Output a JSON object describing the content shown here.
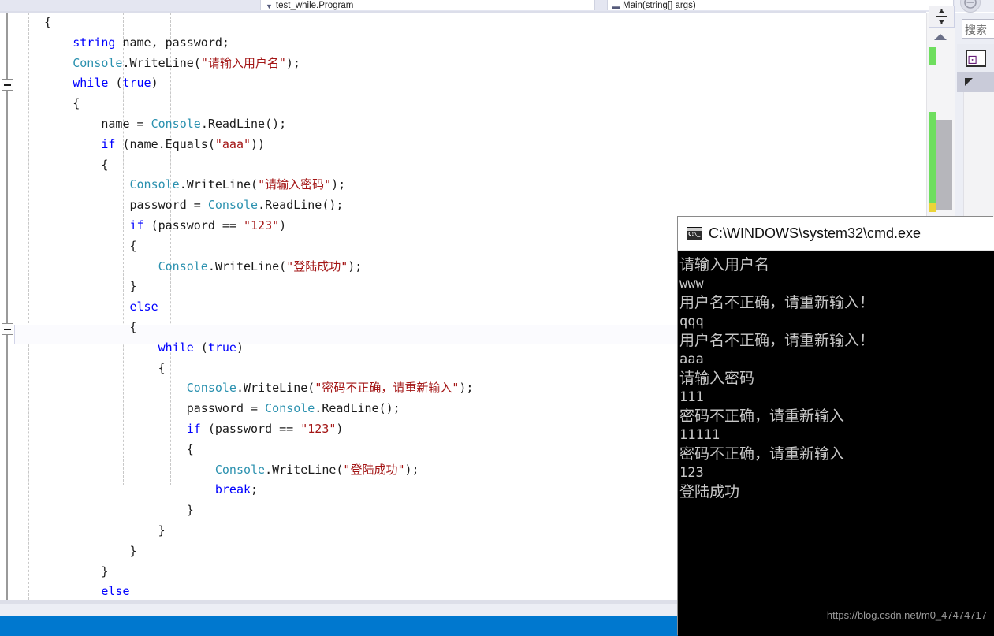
{
  "editor": {
    "tabs": [
      {
        "label": "test_while.Program",
        "icon": "chevron-down-icon"
      },
      {
        "label": "Main(string[] args)",
        "icon": "method-icon"
      }
    ],
    "language": "csharp",
    "current_line_index": 16,
    "colors": {
      "keyword": "#0000ff",
      "type": "#2b91af",
      "string": "#a31515",
      "plain": "#1b1b1b",
      "background": "#ffffff",
      "status_bar": "#0078cf",
      "change_marker": "#6ede5e",
      "warning_marker": "#ebd438"
    },
    "code_lines": [
      [
        {
          "t": "plain",
          "s": "    {"
        }
      ],
      [
        {
          "t": "keyword",
          "s": "        string"
        },
        {
          "t": "plain",
          "s": " name, password;"
        }
      ],
      [
        {
          "t": "type",
          "s": "        Console"
        },
        {
          "t": "plain",
          "s": ".WriteLine("
        },
        {
          "t": "string",
          "s": "\"请输入用户名\""
        },
        {
          "t": "plain",
          "s": ");"
        }
      ],
      [
        {
          "t": "keyword",
          "s": "        while"
        },
        {
          "t": "plain",
          "s": " ("
        },
        {
          "t": "keyword",
          "s": "true"
        },
        {
          "t": "plain",
          "s": ")"
        }
      ],
      [
        {
          "t": "plain",
          "s": "        {"
        }
      ],
      [
        {
          "t": "plain",
          "s": "            name = "
        },
        {
          "t": "type",
          "s": "Console"
        },
        {
          "t": "plain",
          "s": ".ReadLine();"
        }
      ],
      [
        {
          "t": "keyword",
          "s": "            if"
        },
        {
          "t": "plain",
          "s": " (name.Equals("
        },
        {
          "t": "string",
          "s": "\"aaa\""
        },
        {
          "t": "plain",
          "s": "))"
        }
      ],
      [
        {
          "t": "plain",
          "s": "            {"
        }
      ],
      [
        {
          "t": "type",
          "s": "                Console"
        },
        {
          "t": "plain",
          "s": ".WriteLine("
        },
        {
          "t": "string",
          "s": "\"请输入密码\""
        },
        {
          "t": "plain",
          "s": ");"
        }
      ],
      [
        {
          "t": "plain",
          "s": "                password = "
        },
        {
          "t": "type",
          "s": "Console"
        },
        {
          "t": "plain",
          "s": ".ReadLine();"
        }
      ],
      [
        {
          "t": "keyword",
          "s": "                if"
        },
        {
          "t": "plain",
          "s": " (password == "
        },
        {
          "t": "string",
          "s": "\"123\""
        },
        {
          "t": "plain",
          "s": ")"
        }
      ],
      [
        {
          "t": "plain",
          "s": "                {"
        }
      ],
      [
        {
          "t": "type",
          "s": "                    Console"
        },
        {
          "t": "plain",
          "s": ".WriteLine("
        },
        {
          "t": "string",
          "s": "\"登陆成功\""
        },
        {
          "t": "plain",
          "s": ");"
        }
      ],
      [
        {
          "t": "plain",
          "s": "                }"
        }
      ],
      [
        {
          "t": "keyword",
          "s": "                else"
        }
      ],
      [
        {
          "t": "plain",
          "s": "                {"
        }
      ],
      [
        {
          "t": "keyword",
          "s": "                    while"
        },
        {
          "t": "plain",
          "s": " ("
        },
        {
          "t": "keyword",
          "s": "true"
        },
        {
          "t": "plain",
          "s": ")"
        }
      ],
      [
        {
          "t": "plain",
          "s": "                    {"
        }
      ],
      [
        {
          "t": "type",
          "s": "                        Console"
        },
        {
          "t": "plain",
          "s": ".WriteLine("
        },
        {
          "t": "string",
          "s": "\"密码不正确，请重新输入\""
        },
        {
          "t": "plain",
          "s": ");"
        }
      ],
      [
        {
          "t": "plain",
          "s": "                        password = "
        },
        {
          "t": "type",
          "s": "Console"
        },
        {
          "t": "plain",
          "s": ".ReadLine();"
        }
      ],
      [
        {
          "t": "keyword",
          "s": "                        if"
        },
        {
          "t": "plain",
          "s": " (password == "
        },
        {
          "t": "string",
          "s": "\"123\""
        },
        {
          "t": "plain",
          "s": ")"
        }
      ],
      [
        {
          "t": "plain",
          "s": "                        {"
        }
      ],
      [
        {
          "t": "type",
          "s": "                            Console"
        },
        {
          "t": "plain",
          "s": ".WriteLine("
        },
        {
          "t": "string",
          "s": "\"登陆成功\""
        },
        {
          "t": "plain",
          "s": ");"
        }
      ],
      [
        {
          "t": "keyword",
          "s": "                            break"
        },
        {
          "t": "plain",
          "s": ";"
        }
      ],
      [
        {
          "t": "plain",
          "s": "                        }"
        }
      ],
      [
        {
          "t": "plain",
          "s": "                    }"
        }
      ],
      [
        {
          "t": "plain",
          "s": "                }"
        }
      ],
      [
        {
          "t": "plain",
          "s": "            }"
        }
      ],
      [
        {
          "t": "keyword",
          "s": "            else"
        }
      ],
      [
        {
          "t": "plain",
          "s": "            {"
        }
      ]
    ]
  },
  "right_panel": {
    "split_view_icon": "split-horizontal-icon",
    "scroll_up_icon": "scroll-up-arrow-icon",
    "search_placeholder": "搜索",
    "search_value": "搜索",
    "solution_icon": "visual-studio-solution-icon",
    "expander_icon": "triangle-expander-icon"
  },
  "console": {
    "title": "C:\\WINDOWS\\system32\\cmd.exe",
    "icon": "cmd-console-icon",
    "prompt_glyph": "C:\\_",
    "output": [
      {
        "text": "请输入用户名",
        "kind": "cjk"
      },
      {
        "text": "www",
        "kind": "ascii"
      },
      {
        "text": "用户名不正确，请重新输入！",
        "kind": "cjk"
      },
      {
        "text": "qqq",
        "kind": "ascii"
      },
      {
        "text": "用户名不正确，请重新输入！",
        "kind": "cjk"
      },
      {
        "text": "aaa",
        "kind": "ascii"
      },
      {
        "text": "请输入密码",
        "kind": "cjk"
      },
      {
        "text": "111",
        "kind": "ascii"
      },
      {
        "text": "密码不正确，请重新输入",
        "kind": "cjk"
      },
      {
        "text": "11111",
        "kind": "ascii"
      },
      {
        "text": "密码不正确，请重新输入",
        "kind": "cjk"
      },
      {
        "text": "123",
        "kind": "ascii"
      },
      {
        "text": "登陆成功",
        "kind": "cjk"
      }
    ],
    "watermark": "https://blog.csdn.net/m0_47474717"
  }
}
